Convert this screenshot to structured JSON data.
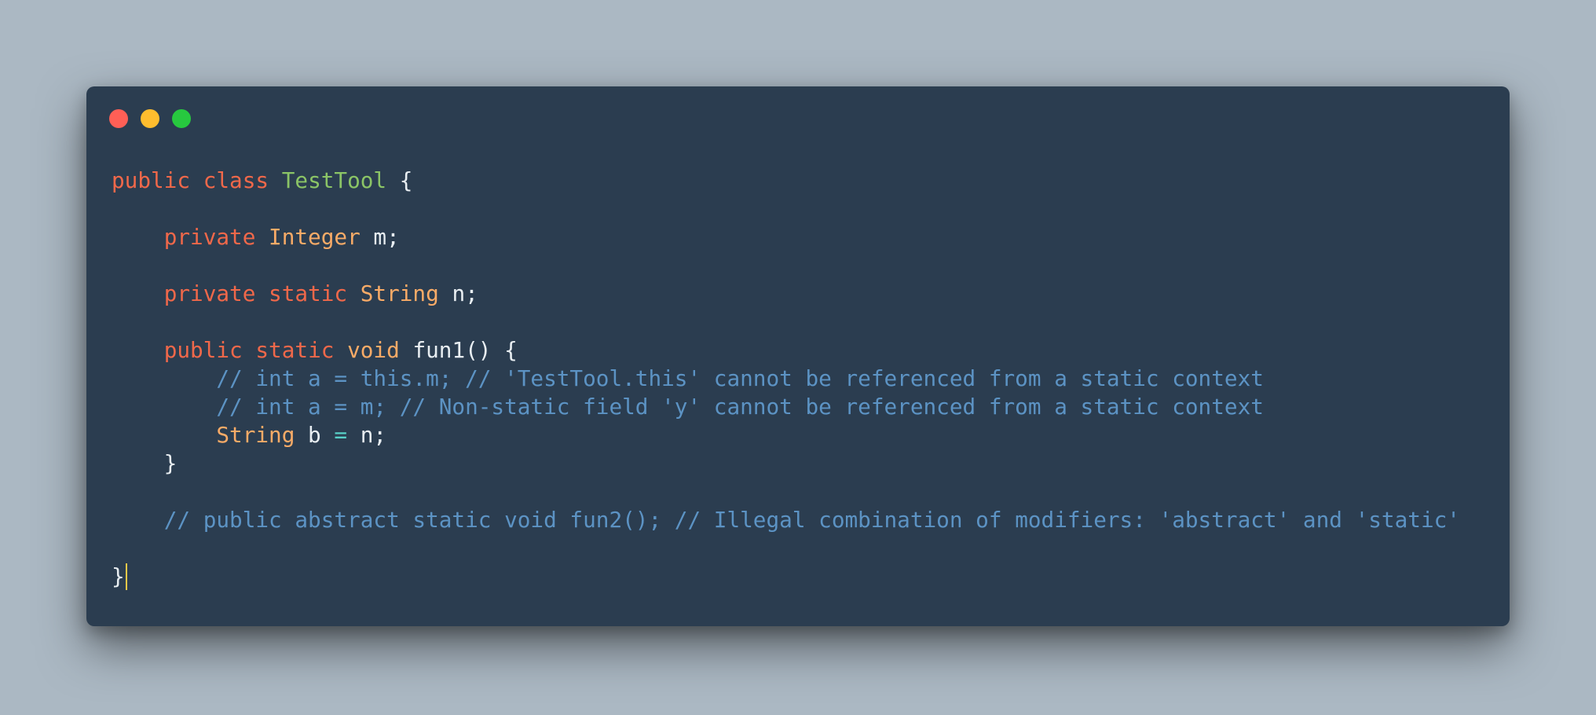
{
  "window": {
    "controls": [
      {
        "name": "close-button",
        "color": "#ff5f56"
      },
      {
        "name": "minimize-button",
        "color": "#ffbd2e"
      },
      {
        "name": "maximize-button",
        "color": "#27c93f"
      }
    ]
  },
  "colors": {
    "background": "#abb8c3",
    "editor_background": "#2b3d50",
    "keyword": "#f0684a",
    "class_name": "#8bc466",
    "type": "#f9ab67",
    "plain": "#e8eef2",
    "comment": "#5c93c4",
    "operator": "#58d0c8",
    "cursor": "#f7c948"
  },
  "code_lines": [
    [
      {
        "t": "public",
        "c": "keyword"
      },
      {
        "t": " ",
        "c": "plain"
      },
      {
        "t": "class",
        "c": "keyword"
      },
      {
        "t": " ",
        "c": "plain"
      },
      {
        "t": "TestTool",
        "c": "class_name"
      },
      {
        "t": " {",
        "c": "plain"
      }
    ],
    [],
    [
      {
        "t": "    ",
        "c": "plain"
      },
      {
        "t": "private",
        "c": "keyword"
      },
      {
        "t": " ",
        "c": "plain"
      },
      {
        "t": "Integer",
        "c": "type"
      },
      {
        "t": " m;",
        "c": "plain"
      }
    ],
    [],
    [
      {
        "t": "    ",
        "c": "plain"
      },
      {
        "t": "private",
        "c": "keyword"
      },
      {
        "t": " ",
        "c": "plain"
      },
      {
        "t": "static",
        "c": "keyword"
      },
      {
        "t": " ",
        "c": "plain"
      },
      {
        "t": "String",
        "c": "type"
      },
      {
        "t": " n;",
        "c": "plain"
      }
    ],
    [],
    [
      {
        "t": "    ",
        "c": "plain"
      },
      {
        "t": "public",
        "c": "keyword"
      },
      {
        "t": " ",
        "c": "plain"
      },
      {
        "t": "static",
        "c": "keyword"
      },
      {
        "t": " ",
        "c": "plain"
      },
      {
        "t": "void",
        "c": "type"
      },
      {
        "t": " fun1() {",
        "c": "plain"
      }
    ],
    [
      {
        "t": "        ",
        "c": "plain"
      },
      {
        "t": "// int a = this.m; // 'TestTool.this' cannot be referenced from a static context",
        "c": "comment"
      }
    ],
    [
      {
        "t": "        ",
        "c": "plain"
      },
      {
        "t": "// int a = m; // Non-static field 'y' cannot be referenced from a static context",
        "c": "comment"
      }
    ],
    [
      {
        "t": "        ",
        "c": "plain"
      },
      {
        "t": "String",
        "c": "type"
      },
      {
        "t": " b ",
        "c": "plain"
      },
      {
        "t": "=",
        "c": "operator"
      },
      {
        "t": " n;",
        "c": "plain"
      }
    ],
    [
      {
        "t": "    }",
        "c": "plain"
      }
    ],
    [],
    [
      {
        "t": "    ",
        "c": "plain"
      },
      {
        "t": "// public abstract static void fun2(); // Illegal combination of modifiers: 'abstract' and 'static'",
        "c": "comment"
      }
    ],
    [],
    [
      {
        "t": "}",
        "c": "plain"
      },
      {
        "cursor": true
      }
    ]
  ]
}
